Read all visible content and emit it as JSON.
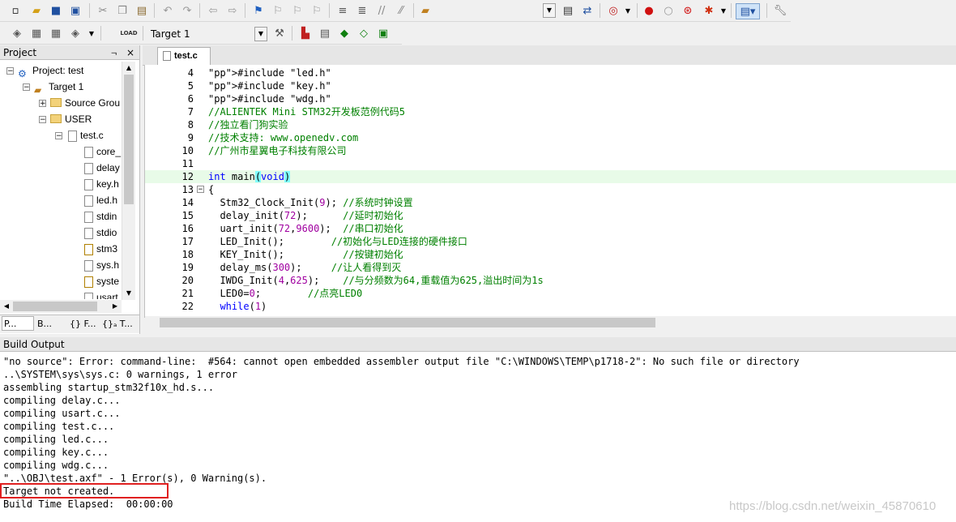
{
  "toolbar2": {
    "target_combo_value": "Target 1"
  },
  "project_panel": {
    "title": "Project",
    "pin_glyph": "ᆨ",
    "close_glyph": "×",
    "tree": [
      {
        "label": "Project: test",
        "icon": "project-icon"
      },
      {
        "label": "Target 1",
        "icon": "target-icon"
      },
      {
        "label": "Source Grou",
        "icon": "folder-icon"
      },
      {
        "label": "USER",
        "icon": "folder-icon"
      },
      {
        "label": "test.c",
        "icon": "file-icon"
      },
      {
        "label": "core_",
        "icon": "file-icon"
      },
      {
        "label": "delay",
        "icon": "file-icon"
      },
      {
        "label": "key.h",
        "icon": "file-icon"
      },
      {
        "label": "led.h",
        "icon": "file-icon"
      },
      {
        "label": "stdin",
        "icon": "file-icon"
      },
      {
        "label": "stdio",
        "icon": "file-icon"
      },
      {
        "label": "stm3",
        "icon": "file-icon"
      },
      {
        "label": "sys.h",
        "icon": "file-icon"
      },
      {
        "label": "syste",
        "icon": "file-icon"
      },
      {
        "label": "usart",
        "icon": "file-icon"
      }
    ],
    "bottom_tabs": [
      "P...",
      "B...",
      "{} F...",
      "{}ₐ T..."
    ]
  },
  "editor": {
    "tab_label": "test.c",
    "lines": [
      {
        "n": "4",
        "text": "#include \"led.h\""
      },
      {
        "n": "5",
        "text": "#include \"key.h\""
      },
      {
        "n": "6",
        "text": "#include \"wdg.h\""
      },
      {
        "n": "7",
        "text": "//ALIENTEK Mini STM32开发板范例代码5"
      },
      {
        "n": "8",
        "text": "//独立看门狗实验"
      },
      {
        "n": "9",
        "text": "//技术支持: www.openedv.com"
      },
      {
        "n": "10",
        "text": "//广州市星翼电子科技有限公司"
      },
      {
        "n": "11",
        "text": ""
      },
      {
        "n": "12",
        "text": "int main(void)"
      },
      {
        "n": "13",
        "text": "{"
      },
      {
        "n": "14",
        "text": "  Stm32_Clock_Init(9); //系统时钟设置"
      },
      {
        "n": "15",
        "text": "  delay_init(72);      //延时初始化"
      },
      {
        "n": "16",
        "text": "  uart_init(72,9600);  //串口初始化"
      },
      {
        "n": "17",
        "text": "  LED_Init();        //初始化与LED连接的硬件接口"
      },
      {
        "n": "18",
        "text": "  KEY_Init();          //按键初始化"
      },
      {
        "n": "19",
        "text": "  delay_ms(300);     //让人看得到灭"
      },
      {
        "n": "20",
        "text": "  IWDG_Init(4,625);    //与分频数为64,重载值为625,溢出时间为1s"
      },
      {
        "n": "21",
        "text": "  LED0=0;        //点亮LED0"
      },
      {
        "n": "22",
        "text": "  while(1)"
      }
    ]
  },
  "build_output": {
    "title": "Build Output",
    "lines": [
      "\"no source\": Error: command-line:  #564: cannot open embedded assembler output file \"C:\\WINDOWS\\TEMP\\p1718-2\": No such file or directory",
      "..\\SYSTEM\\sys\\sys.c: 0 warnings, 1 error",
      "assembling startup_stm32f10x_hd.s...",
      "compiling delay.c...",
      "compiling usart.c...",
      "compiling test.c...",
      "compiling led.c...",
      "compiling key.c...",
      "compiling wdg.c...",
      "\"..\\OBJ\\test.axf\" - 1 Error(s), 0 Warning(s).",
      "Target not created.",
      "Build Time Elapsed:  00:00:00"
    ],
    "watermark": "https://blog.csdn.net/weixin_45870610"
  },
  "colors": {
    "highlight_box": "#e02020",
    "current_line": "#e8fbe8",
    "bracket_match": "#80ffff"
  }
}
